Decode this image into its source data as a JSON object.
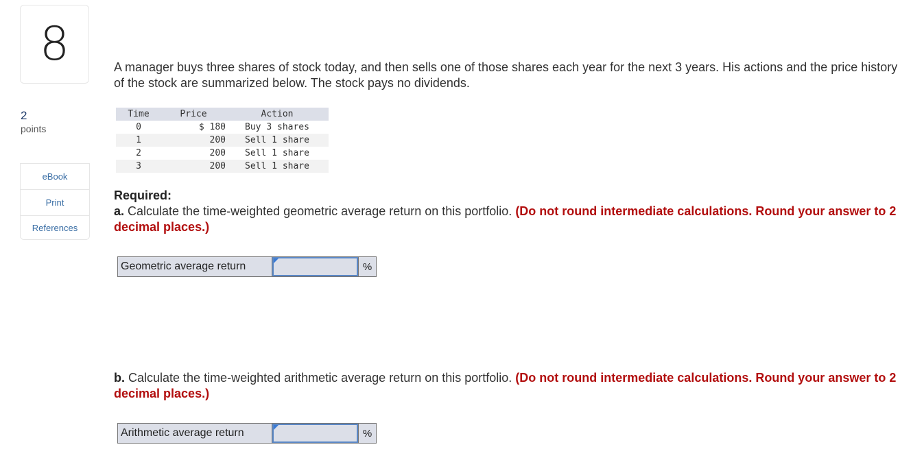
{
  "question": {
    "number": "8",
    "points_value": "2",
    "points_label": "points"
  },
  "side_links": [
    {
      "label": "eBook"
    },
    {
      "label": "Print"
    },
    {
      "label": "References"
    }
  ],
  "intro": "A manager buys three shares of stock today, and then sells one of those shares each year for the next 3 years. His actions and the price history of the stock are summarized below. The stock pays no dividends.",
  "table": {
    "headers": [
      "Time",
      "Price",
      "Action"
    ],
    "rows": [
      {
        "time": "0",
        "price": "$ 180",
        "action": "Buy 3 shares"
      },
      {
        "time": "1",
        "price": "200",
        "action": "Sell 1 share"
      },
      {
        "time": "2",
        "price": "200",
        "action": "Sell 1 share"
      },
      {
        "time": "3",
        "price": "200",
        "action": "Sell 1 share"
      }
    ]
  },
  "required": {
    "title": "Required:",
    "part_a": {
      "prefix": "a.",
      "text": " Calculate the time-weighted geometric average return on this portfolio. ",
      "instruction": "(Do not round intermediate calculations. Round your answer to 2 decimal places.)",
      "answer_label": "Geometric average return",
      "answer_value": "",
      "unit": "%"
    },
    "part_b": {
      "prefix": "b.",
      "text": " Calculate the time-weighted arithmetic average return on this portfolio. ",
      "instruction": "(Do not round intermediate calculations. Round your answer to 2 decimal places.)",
      "answer_label": "Arithmetic average return",
      "answer_value": "",
      "unit": "%"
    }
  }
}
